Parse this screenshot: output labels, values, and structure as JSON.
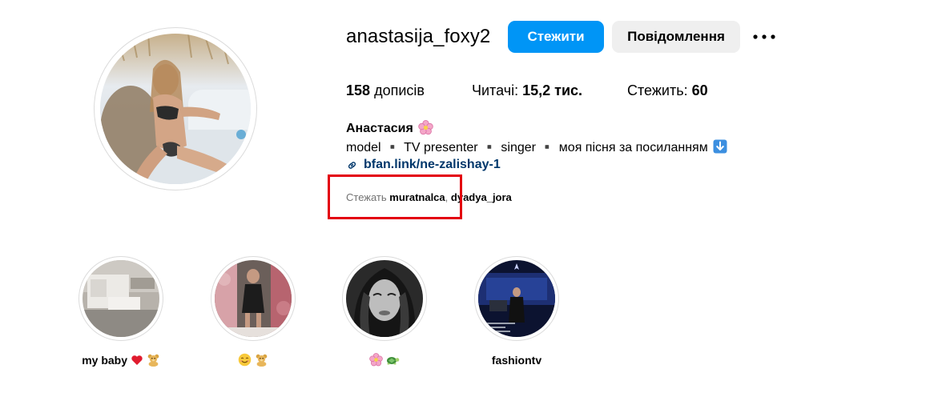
{
  "profile": {
    "username": "anastasija_foxy2",
    "follow_label": "Стежити",
    "message_label": "Повідомлення",
    "more_icon": "more-options-icon"
  },
  "stats": {
    "posts_count": "158",
    "posts_label": "дописів",
    "followers_label": "Читачі:",
    "followers_count": "15,2 тис.",
    "following_label": "Стежить:",
    "following_count": "60"
  },
  "bio": {
    "full_name": "Анастасия",
    "full_name_emoji": "flower-emoji",
    "text": "model ▪️ TV presenter ▪️ singer ▪️ моя пісня за посиланням",
    "text_emoji": "down-arrow-emoji",
    "link_icon": "link-icon",
    "link_text": "bfan.link/ne-zalishay-1"
  },
  "followed_by": {
    "prefix": "Стежать",
    "names": [
      "muratnalca",
      "dyadya_jora"
    ]
  },
  "highlights": [
    {
      "label": "my baby",
      "emojis": [
        "heart-emoji",
        "teddy-bear-emoji"
      ]
    },
    {
      "label": "",
      "emojis": [
        "smiling-face-emoji",
        "teddy-bear-emoji"
      ]
    },
    {
      "label": "",
      "emojis": [
        "flower-emoji",
        "turtle-emoji"
      ]
    },
    {
      "label": "fashiontv",
      "emojis": []
    }
  ],
  "colors": {
    "accent": "#0095f6",
    "link": "#00376b",
    "muted": "#737373",
    "annotation": "#e3000f"
  }
}
